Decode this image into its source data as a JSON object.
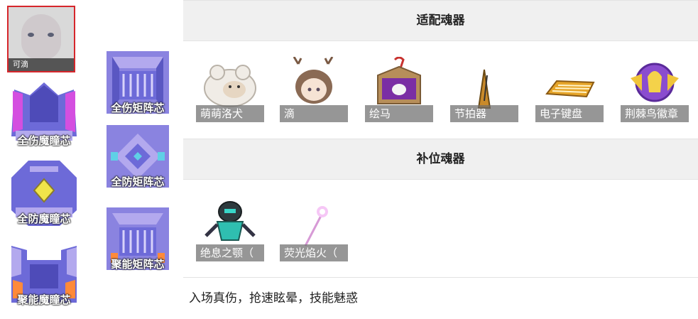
{
  "character": {
    "name": "可滴"
  },
  "eye_chips": [
    {
      "label": "全伤魔瞳芯",
      "accent": "#c83cd6"
    },
    {
      "label": "全防魔瞳芯",
      "accent": "#f0e44a"
    },
    {
      "label": "聚能魔瞳芯",
      "accent": "#ff8a3a"
    }
  ],
  "matrix_chips": [
    {
      "label": "全伤矩阵芯",
      "accent": "#9a6bd6"
    },
    {
      "label": "全防矩阵芯",
      "accent": "#5fd0e6"
    },
    {
      "label": "聚能矩阵芯",
      "accent": "#ff8a3a"
    }
  ],
  "sections": {
    "fit_title": "适配魂器",
    "fit_items": [
      {
        "name": "萌萌洛犬",
        "icon": "sheep-plush-icon"
      },
      {
        "name": "滴",
        "icon": "antler-girl-icon"
      },
      {
        "name": "绘马",
        "icon": "ema-plaque-icon"
      },
      {
        "name": "节拍器",
        "icon": "metronome-icon"
      },
      {
        "name": "电子键盘",
        "icon": "keyboard-icon"
      },
      {
        "name": "荆棘鸟徽章",
        "icon": "bird-badge-icon"
      }
    ],
    "sub_title": "补位魂器",
    "sub_items": [
      {
        "name": "绝息之颚（",
        "icon": "mech-warrior-icon"
      },
      {
        "name": "荧光焰火（",
        "icon": "sparkler-icon"
      }
    ],
    "description": "入场真伤，抢速眩晕，技能魅惑"
  },
  "colors": {
    "chip_body": "#6d6ad8",
    "chip_light": "#b3a9ee",
    "portrait_border": "#d6262b",
    "header_bg": "#f0f0f0"
  }
}
